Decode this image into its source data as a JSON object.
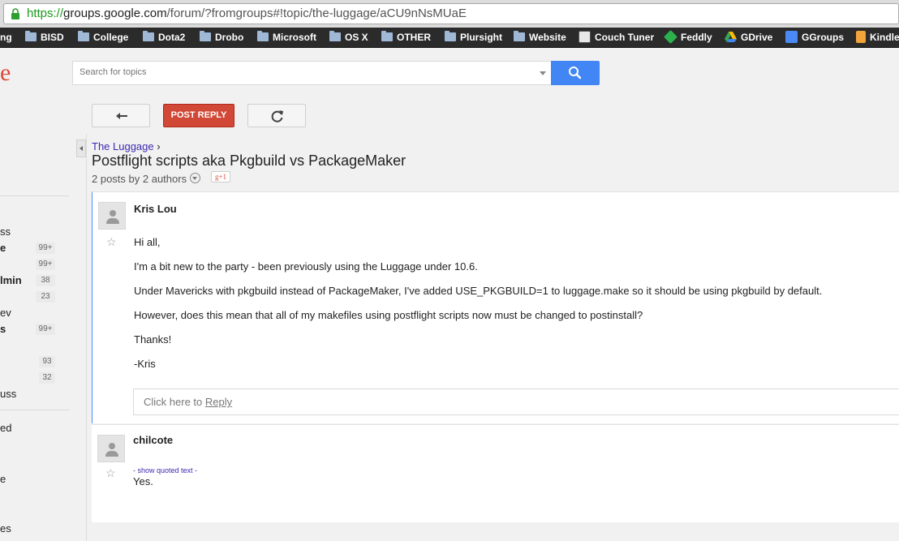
{
  "browser": {
    "url_scheme": "https://",
    "url_host": "groups.google.com",
    "url_path": "/forum/?fromgroups#!topic/the-luggage/aCU9nNsMUaE"
  },
  "bookmarks": [
    {
      "label": "ng",
      "type": "partial"
    },
    {
      "label": "BISD",
      "type": "folder"
    },
    {
      "label": "College",
      "type": "folder"
    },
    {
      "label": "Dota2",
      "type": "folder"
    },
    {
      "label": "Drobo",
      "type": "folder"
    },
    {
      "label": "Microsoft",
      "type": "folder"
    },
    {
      "label": "OS X",
      "type": "folder"
    },
    {
      "label": "OTHER",
      "type": "folder"
    },
    {
      "label": "Plursight",
      "type": "folder"
    },
    {
      "label": "Website",
      "type": "folder"
    },
    {
      "label": "Couch Tuner",
      "type": "site",
      "icon": "couch-tuner-icon"
    },
    {
      "label": "Feddly",
      "type": "site",
      "icon": "feedly-icon"
    },
    {
      "label": "GDrive",
      "type": "site",
      "icon": "gdrive-icon"
    },
    {
      "label": "GGroups",
      "type": "site",
      "icon": "ggroups-icon"
    },
    {
      "label": "Kindle",
      "type": "site",
      "icon": "kindle-icon"
    }
  ],
  "header": {
    "logo_fragment": "e",
    "search_placeholder": "Search for topics"
  },
  "toolbar": {
    "post_reply_label": "POST REPLY"
  },
  "leftnav": {
    "items": [
      {
        "label": "ss",
        "count": ""
      },
      {
        "label": "e",
        "count": "99+",
        "bold": true
      },
      {
        "label": "",
        "count": "99+"
      },
      {
        "label": "lmin",
        "count": "38",
        "bold": true
      },
      {
        "label": "",
        "count": "23"
      },
      {
        "label": "ev",
        "count": ""
      },
      {
        "label": "s",
        "count": "99+",
        "bold": true
      },
      {
        "label": "",
        "count": "93"
      },
      {
        "label": "",
        "count": "32"
      },
      {
        "label": "uss",
        "count": ""
      },
      {
        "label": "ed",
        "count": ""
      },
      {
        "label": "e",
        "count": ""
      },
      {
        "label": "es",
        "count": ""
      }
    ]
  },
  "topic": {
    "group_name": "The Luggage",
    "crumb_separator": "›",
    "title": "Postflight scripts aka Pkgbuild vs PackageMaker",
    "meta": "2 posts by 2 authors",
    "plusone": "g+1"
  },
  "posts": [
    {
      "author": "Kris Lou",
      "lines": [
        "Hi all,",
        "I'm a bit new to the party - been previously using the Luggage under 10.6.",
        "Under Mavericks with pkgbuild instead of PackageMaker, I've added USE_PKGBUILD=1 to luggage.make so it should be using pkgbuild by default.",
        "However, does this mean that all of my makefiles using postflight scripts now must be changed to postinstall?",
        "Thanks!",
        "-Kris"
      ],
      "reply_prefix": "Click here to ",
      "reply_link": "Reply"
    },
    {
      "author": "chilcote",
      "quoted_toggle": "- show quoted text -",
      "lines": [
        "Yes."
      ]
    }
  ],
  "colors": {
    "accent_red": "#d14836",
    "search_blue": "#4285f4",
    "link_purple": "#3d29b3",
    "focus_blue": "#4d90fe"
  }
}
